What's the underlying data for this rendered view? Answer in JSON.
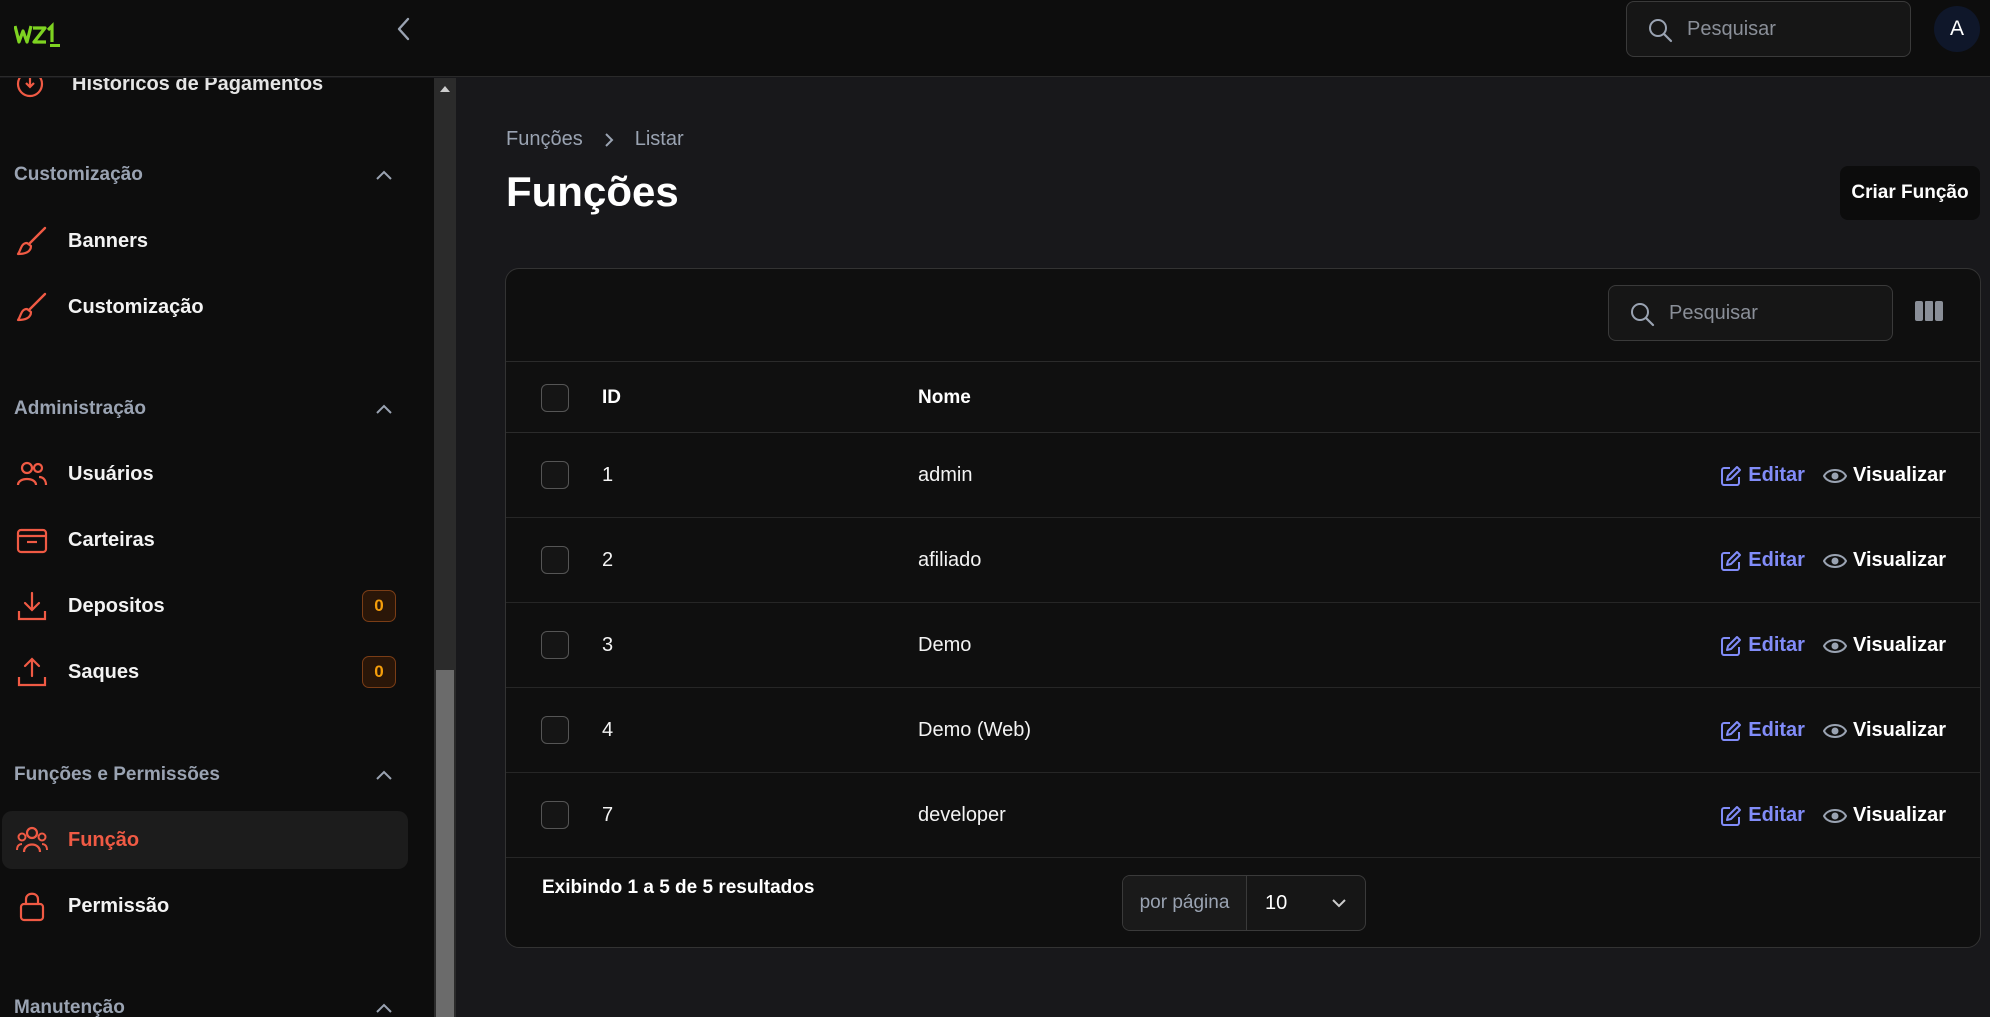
{
  "header": {
    "search_placeholder": "Pesquisar",
    "avatar_initial": "A"
  },
  "sidebar": {
    "partial_item_label": "Históricos de Pagamentos",
    "sections": [
      {
        "title": "Customização",
        "items": [
          "Banners",
          "Customização"
        ]
      },
      {
        "title": "Administração",
        "items": [
          "Usuários",
          "Carteiras",
          "Depositos",
          "Saques"
        ]
      },
      {
        "title": "Funções e Permissões",
        "items": [
          "Função",
          "Permissão"
        ]
      },
      {
        "title": "Manutenção"
      }
    ],
    "badges": {
      "depositos": "0",
      "saques": "0"
    },
    "active_item": "Função",
    "accent_color": "#f05a44"
  },
  "breadcrumb": {
    "root": "Funções",
    "current": "Listar"
  },
  "page": {
    "title": "Funções",
    "create_button": "Criar Função"
  },
  "table": {
    "search_placeholder": "Pesquisar",
    "columns": [
      "ID",
      "Nome"
    ],
    "rows": [
      {
        "id": "1",
        "name": "admin"
      },
      {
        "id": "2",
        "name": "afiliado"
      },
      {
        "id": "3",
        "name": "Demo"
      },
      {
        "id": "4",
        "name": "Demo (Web)"
      },
      {
        "id": "7",
        "name": "developer"
      }
    ],
    "actions": {
      "edit": "Editar",
      "view": "Visualizar"
    },
    "footer": {
      "summary": "Exibindo 1 a 5 de 5 resultados",
      "per_page_label": "por página",
      "per_page_value": "10"
    }
  }
}
